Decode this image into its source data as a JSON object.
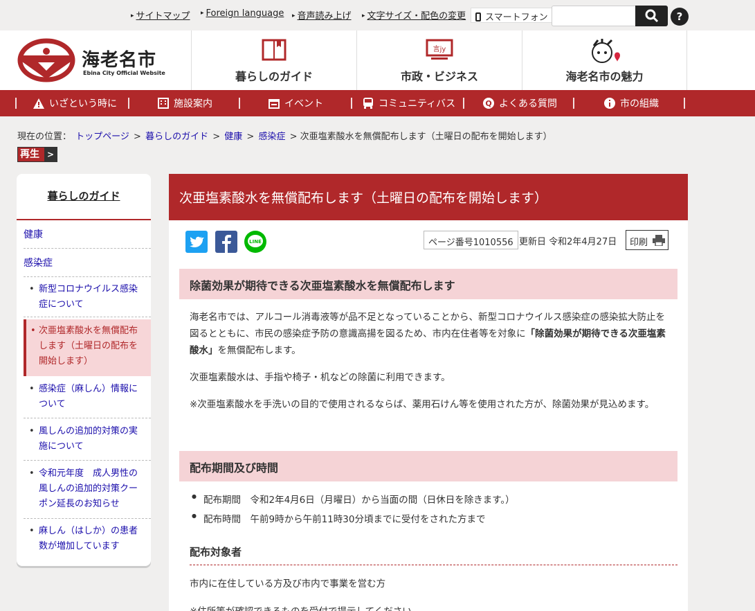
{
  "utility": {
    "links": [
      "サイトマップ",
      "Foreign language",
      "音声読み上げ",
      "文字サイズ・配色の変更"
    ],
    "smartphone": "スマートフォン",
    "search_placeholder": "",
    "help": "?"
  },
  "header": {
    "logo_name": "海老名市",
    "logo_sub": "Ebina City Official Website",
    "nav": [
      "暮らしのガイド",
      "市政・ビジネス",
      "海老名市の魅力"
    ]
  },
  "rednav": {
    "items": [
      {
        "label": "いざという時に",
        "icon": "warning-icon"
      },
      {
        "label": "施設案内",
        "icon": "building-icon"
      },
      {
        "label": "イベント",
        "icon": "calendar-icon"
      },
      {
        "label": "コミュニティバス",
        "icon": "bus-icon"
      },
      {
        "label": "よくある質問",
        "icon": "question-icon"
      },
      {
        "label": "市の組織",
        "icon": "info-icon"
      }
    ]
  },
  "breadcrumb": {
    "prefix": "現在の位置：",
    "links": [
      "トップページ",
      "暮らしのガイド",
      "健康",
      "感染症"
    ],
    "current": "次亜塩素酸水を無償配布します（土曜日の配布を開始します）"
  },
  "play_label": "再生",
  "sidebar": {
    "title": "暮らしのガイド",
    "categories": [
      "健康",
      "感染症"
    ],
    "items": [
      "新型コロナウイルス感染症について",
      "次亜塩素酸水を無償配布します（土曜日の配布を開始します）",
      "感染症（麻しん）情報について",
      "風しんの追加的対策の実施について",
      "令和元年度　成人男性の風しんの追加的対策クーポン延長のお知らせ",
      "麻しん（はしか）の患者数が増加しています"
    ]
  },
  "article": {
    "title": "次亜塩素酸水を無償配布します（土曜日の配布を開始します）",
    "page_number": "ページ番号1010556",
    "updated": "更新日 令和2年4月27日",
    "print": "印刷",
    "section1_heading": "除菌効果が期待できる次亜塩素酸水を無償配布します",
    "para1_a": "海老名市では、アルコール消毒液等が品不足となっていることから、新型コロナウイルス感染症の感染拡大防止を図るとともに、市民の感染症予防の意識高揚を図るため、市内在住者等を対象に",
    "para1_bold": "「除菌効果が期待できる次亜塩素酸水」",
    "para1_b": "を無償配布します。",
    "para2": "次亜塩素酸水は、手指や椅子・机などの除菌に利用できます。",
    "para3": "※次亜塩素酸水を手洗いの目的で使用されるならば、薬用石けん等を使用された方が、除菌効果が見込めます。",
    "section2_heading": "配布期間及び時間",
    "bullets": [
      "配布期間　令和2年4月6日（月曜日）から当面の間（日休日を除きます。）",
      "配布時間　午前9時から午前11時30分頃までに受付をされた方まで"
    ],
    "section3_heading": "配布対象者",
    "para4": "市内に在住している方及び市内で事業を営む方",
    "para5": "※住所等が確認できるものを受付で提示してください。"
  },
  "colors": {
    "brand_red": "#b0282a",
    "pink": "#f5d3d6",
    "twitter": "#1da1f2",
    "facebook": "#3b5998",
    "line": "#00b900"
  }
}
